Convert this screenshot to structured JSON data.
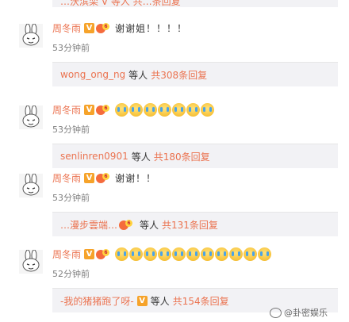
{
  "top_cut_text": "…沃滨栾 V 等人 共…条回复",
  "comments": [
    {
      "user": "周冬雨",
      "verified": "V",
      "level_num": "6",
      "text": "谢谢姐！！！！",
      "emoji_count": 0,
      "time": "53分钟前",
      "reply": {
        "user": "wong_ong_ng",
        "suffix": "等人",
        "total": "共308条回复",
        "user_has_badge": false
      }
    },
    {
      "user": "周冬雨",
      "verified": "V",
      "level_num": "6",
      "text": "",
      "emoji_count": 7,
      "emoji_name": "crying-emoji",
      "time": "53分钟前",
      "reply": {
        "user": "senlinren0901",
        "suffix": "等人",
        "total": "共180条回复",
        "user_has_badge": false
      }
    },
    {
      "user": "周冬雨",
      "verified": "V",
      "level_num": "6",
      "text": "谢谢！！",
      "emoji_count": 0,
      "time": "53分钟前",
      "reply": {
        "user": "…漫步雲端…",
        "suffix": "等人",
        "total": "共131条回复",
        "user_has_badge": true
      }
    },
    {
      "user": "周冬雨",
      "verified": "V",
      "level_num": "6",
      "text": "",
      "emoji_count": 11,
      "emoji_name": "crying-emoji",
      "time": "52分钟前",
      "reply": {
        "user": "-我的猪猪跑了呀-",
        "suffix": "等人",
        "total": "共154条回复",
        "user_has_badge": false,
        "user_has_v": true
      }
    }
  ],
  "watermark": "@卦密娱乐",
  "colors": {
    "accent": "#eb7350",
    "reply_bg": "#f2f2f5",
    "time": "#808080"
  }
}
